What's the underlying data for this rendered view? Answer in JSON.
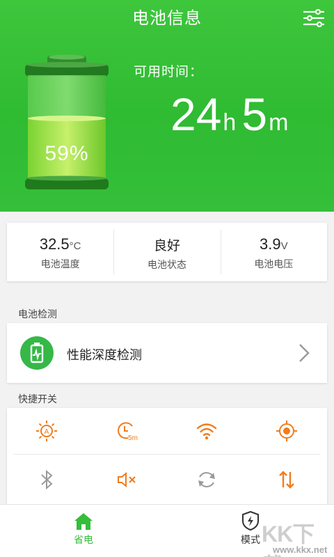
{
  "header": {
    "title": "电池信息"
  },
  "battery": {
    "percent_label": "59%",
    "level": 0.59
  },
  "time": {
    "label": "可用时间：",
    "hours": "24",
    "hours_unit": "h",
    "minutes": "5",
    "minutes_unit": "m"
  },
  "stats": [
    {
      "value": "32.5",
      "unit": "°C",
      "label": "电池温度"
    },
    {
      "value": "良好",
      "unit": "",
      "label": "电池状态"
    },
    {
      "value": "3.9",
      "unit": "V",
      "label": "电池电压"
    }
  ],
  "detection": {
    "section_label": "电池检测",
    "item_label": "性能深度检测"
  },
  "quick_switches": {
    "section_label": "快捷开关",
    "icons": [
      "auto-brightness-icon",
      "screen-timeout-icon",
      "wifi-icon",
      "gps-icon",
      "bluetooth-icon",
      "mute-icon",
      "auto-rotate-icon",
      "mobile-data-icon"
    ],
    "timeout_badge": "5m"
  },
  "nav": [
    {
      "label": "省电",
      "icon": "home-icon",
      "active": true
    },
    {
      "label": "模式",
      "icon": "shield-bolt-icon",
      "active": false
    }
  ],
  "watermark": {
    "text": "KK下载",
    "url": "www.kkx.net"
  },
  "colors": {
    "green": "#36bd3a",
    "orange": "#f07c1c",
    "gray_icon": "#999999"
  }
}
